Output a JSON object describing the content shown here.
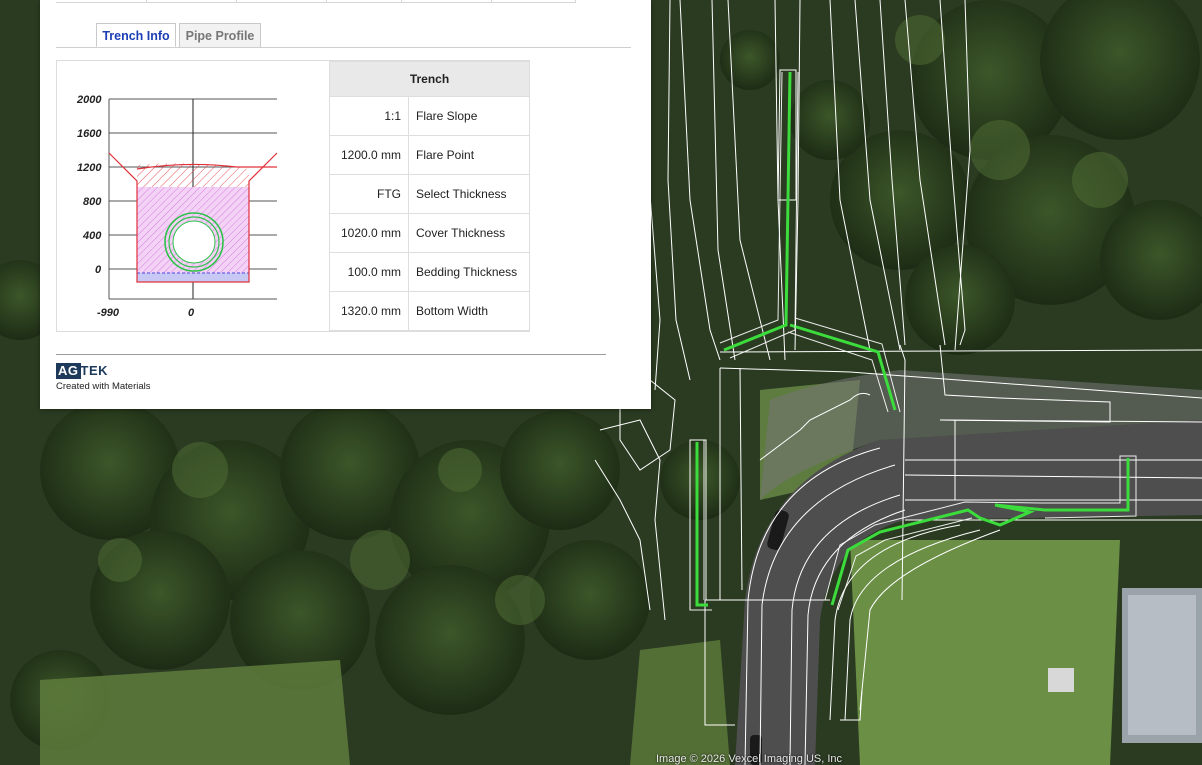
{
  "tabs": {
    "trench_info": "Trench Info",
    "pipe_profile": "Pipe Profile"
  },
  "diagram": {
    "y_ticks": [
      "2000",
      "1600",
      "1200",
      "800",
      "400",
      "0"
    ],
    "x_ticks": [
      "-990",
      "0"
    ]
  },
  "table": {
    "header": "Trench",
    "rows": [
      {
        "value": "1:1",
        "label": "Flare Slope"
      },
      {
        "value": "1200.0 mm",
        "label": "Flare Point"
      },
      {
        "value": "FTG",
        "label": "Select Thickness"
      },
      {
        "value": "1020.0 mm",
        "label": "Cover Thickness"
      },
      {
        "value": "100.0 mm",
        "label": "Bedding Thickness"
      },
      {
        "value": "1320.0 mm",
        "label": "Bottom Width"
      }
    ]
  },
  "logo": {
    "mark": "AG",
    "rest": "TEK",
    "subtitle": "Created with Materials"
  },
  "map": {
    "credit": "Image © 2026 Vexcel Imaging US, Inc"
  },
  "colors": {
    "tab_active": "#1c3fb6",
    "trench_outline": "#e0303a",
    "pipe": "#2fc24a",
    "fill_zone": "#d98ae0",
    "highlight_lines": "#3bdc3b",
    "linework": "#ffffff",
    "road": "#4e4e4e"
  }
}
